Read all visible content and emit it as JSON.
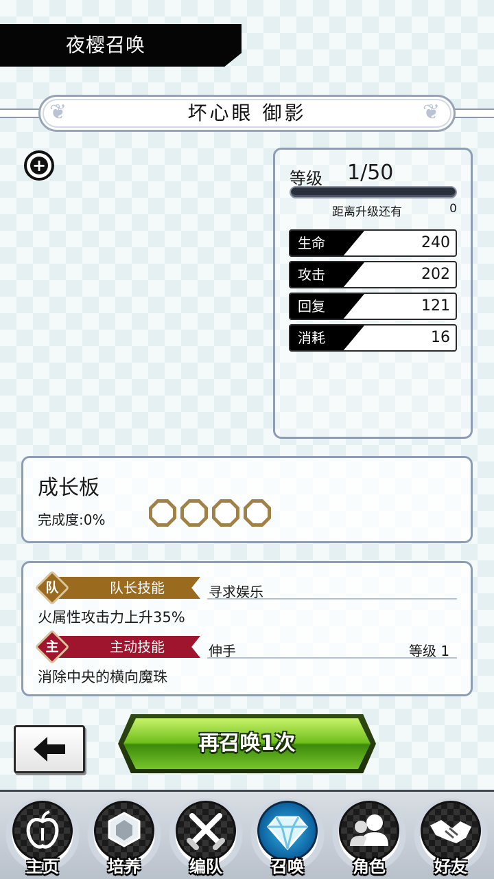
{
  "header": {
    "title": "夜樱召唤"
  },
  "character": {
    "name": "坏心眼 御影"
  },
  "stats": {
    "level_label": "等级",
    "level_value": "1/50",
    "exp_label": "距离升级还有",
    "exp_value": "0",
    "rows": [
      {
        "label": "生命",
        "value": "240"
      },
      {
        "label": "攻击",
        "value": "202"
      },
      {
        "label": "回复",
        "value": "121"
      },
      {
        "label": "消耗",
        "value": "16"
      }
    ]
  },
  "growth": {
    "title": "成长板",
    "completion_label": "完成度:0%",
    "slots_filled": 0,
    "slots_total": 4
  },
  "skills": {
    "leader": {
      "badge": "队",
      "tag": "队长技能",
      "name": "寻求娱乐",
      "description": "火属性攻击力上升35%",
      "color": "#9a6a1e"
    },
    "active": {
      "badge": "主",
      "tag": "主动技能",
      "name": "伸手",
      "level": "等级 1",
      "description": "消除中央的横向魔珠",
      "color": "#a0152e"
    }
  },
  "buttons": {
    "back_icon": "arrow-left-icon",
    "resummon": "再召唤1次"
  },
  "nav": [
    {
      "label": "主页",
      "icon": "apple-icon"
    },
    {
      "label": "培养",
      "icon": "gem-icon"
    },
    {
      "label": "编队",
      "icon": "crossed-swords-icon"
    },
    {
      "label": "召唤",
      "icon": "diamond-icon",
      "active": true
    },
    {
      "label": "角色",
      "icon": "people-icon"
    },
    {
      "label": "好友",
      "icon": "handshake-icon"
    }
  ]
}
